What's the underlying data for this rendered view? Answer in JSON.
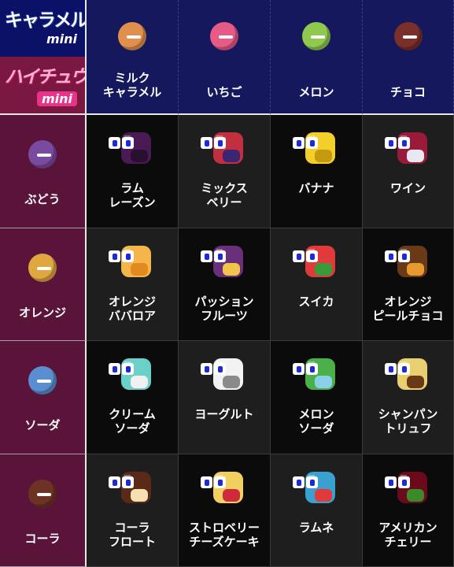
{
  "logos": {
    "top": {
      "main": "キャラメル",
      "sub": "mini"
    },
    "bottom": {
      "main": "ハイチュウ",
      "sub": "mini"
    }
  },
  "columns": [
    {
      "label": "ミルク\nキャラメル",
      "color": "#e0904c",
      "icon": "milk-caramel-candy-icon"
    },
    {
      "label": "いちご",
      "color": "#e65a86",
      "icon": "strawberry-candy-icon"
    },
    {
      "label": "メロン",
      "color": "#8fc94e",
      "icon": "melon-candy-icon"
    },
    {
      "label": "チョコ",
      "color": "#7a2f2a",
      "icon": "chocolate-candy-icon"
    }
  ],
  "rows": [
    {
      "label": "ぶどう",
      "color": "#7a4aa0",
      "icon": "grape-candy-icon",
      "items": [
        {
          "label": "ラム\nレーズン",
          "icon": "rum-raisin-icon",
          "c1": "#4a1a55",
          "c2": "#2a1030"
        },
        {
          "label": "ミックス\nベリー",
          "icon": "mixed-berry-icon",
          "c1": "#c23040",
          "c2": "#3b2470"
        },
        {
          "label": "バナナ",
          "icon": "banana-icon",
          "c1": "#f3cf2a",
          "c2": "#c59a10"
        },
        {
          "label": "ワイン",
          "icon": "wine-glass-icon",
          "c1": "#9a1a3a",
          "c2": "#e8e8f0"
        }
      ]
    },
    {
      "label": "オレンジ",
      "color": "#e0a640",
      "icon": "orange-candy-icon",
      "items": [
        {
          "label": "オレンジ\nババロア",
          "icon": "orange-bavarois-icon",
          "c1": "#f4b54a",
          "c2": "#e08a20"
        },
        {
          "label": "パッション\nフルーツ",
          "icon": "passion-fruit-icon",
          "c1": "#6a2f7a",
          "c2": "#f2c54a"
        },
        {
          "label": "スイカ",
          "icon": "watermelon-icon",
          "c1": "#e03a3a",
          "c2": "#3a9a3a"
        },
        {
          "label": "オレンジ\nピールチョコ",
          "icon": "orange-peel-chocolate-icon",
          "c1": "#6a3a18",
          "c2": "#e69a30"
        }
      ]
    },
    {
      "label": "ソーダ",
      "color": "#5a8ed0",
      "icon": "soda-candy-icon",
      "items": [
        {
          "label": "クリーム\nソーダ",
          "icon": "cream-soda-icon",
          "c1": "#6ad0c8",
          "c2": "#f0f0f0"
        },
        {
          "label": "ヨーグルト",
          "icon": "yogurt-icon",
          "c1": "#f2f2f2",
          "c2": "#8a8a8a"
        },
        {
          "label": "メロン\nソーダ",
          "icon": "melon-soda-icon",
          "c1": "#4ab04a",
          "c2": "#8ad0e8"
        },
        {
          "label": "シャンパン\nトリュフ",
          "icon": "champagne-truffle-icon",
          "c1": "#e8d070",
          "c2": "#6a3a18"
        }
      ]
    },
    {
      "label": "コーラ",
      "color": "#6e3225",
      "icon": "cola-candy-icon",
      "items": [
        {
          "label": "コーラ\nフロート",
          "icon": "cola-float-icon",
          "c1": "#5a2a18",
          "c2": "#f4e0b0"
        },
        {
          "label": "ストロベリー\nチーズケーキ",
          "icon": "strawberry-cheesecake-icon",
          "c1": "#f2d060",
          "c2": "#d02a3a"
        },
        {
          "label": "ラムネ",
          "icon": "ramune-bottle-icon",
          "c1": "#3aa0d0",
          "c2": "#e03a3a"
        },
        {
          "label": "アメリカン\nチェリー",
          "icon": "american-cherry-icon",
          "c1": "#6a0a1a",
          "c2": "#3a8a2a"
        }
      ]
    }
  ]
}
